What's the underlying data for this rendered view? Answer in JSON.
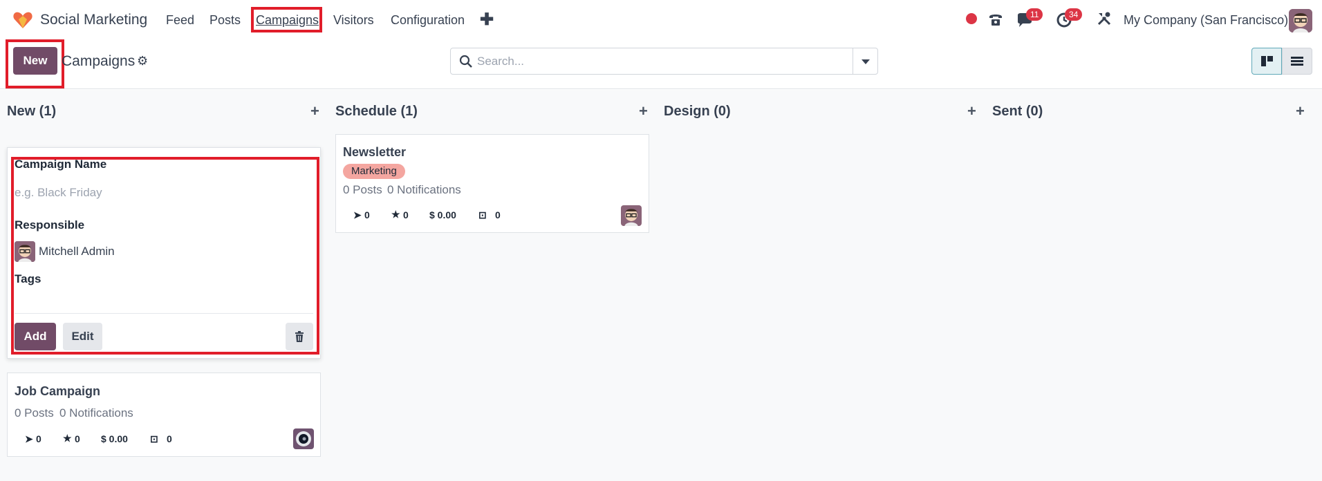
{
  "nav": {
    "app_name": "Social Marketing",
    "items": [
      "Feed",
      "Posts",
      "Campaigns",
      "Visitors",
      "Configuration"
    ],
    "active": "Campaigns",
    "plus": "✚",
    "messages_count": "11",
    "activities_count": "34",
    "company": "My Company (San Francisco)"
  },
  "control_panel": {
    "new_label": "New",
    "title": "Campaigns",
    "search_placeholder": "Search..."
  },
  "columns": [
    {
      "title": "New (1)"
    },
    {
      "title": "Schedule (1)"
    },
    {
      "title": "Design (0)"
    },
    {
      "title": "Sent (0)"
    }
  ],
  "quick_create": {
    "name_label": "Campaign Name",
    "name_placeholder": "e.g. Black Friday",
    "responsible_label": "Responsible",
    "responsible_value": "Mitchell Admin",
    "tags_label": "Tags",
    "add_label": "Add",
    "edit_label": "Edit"
  },
  "cards": {
    "job": {
      "title": "Job Campaign",
      "posts": "0 Posts",
      "notifications": "0 Notifications",
      "clicks": "0",
      "stars": "0",
      "revenue": "$ 0.00",
      "cost": "0"
    },
    "newsletter": {
      "title": "Newsletter",
      "tag": "Marketing",
      "posts": "0 Posts",
      "notifications": "0 Notifications",
      "clicks": "0",
      "stars": "0",
      "revenue": "$ 0.00",
      "cost": "0"
    }
  },
  "colors": {
    "brand": "#714b67",
    "highlight": "#e11d2a",
    "badge": "#dc3545",
    "tag": "#f4a6a0"
  }
}
